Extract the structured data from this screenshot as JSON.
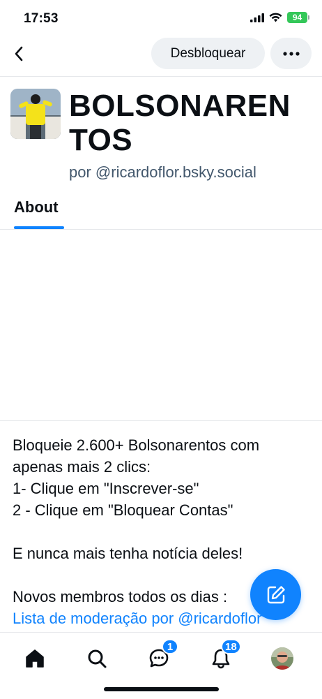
{
  "status_bar": {
    "time": "17:53",
    "battery": "94",
    "battery_color": "#34c759"
  },
  "nav": {
    "unblock_label": "Desbloquear"
  },
  "list": {
    "title": "BOLSONARENTOS",
    "owner": "por @ricardoflor.bsky.social"
  },
  "tabs": {
    "about_label": "About"
  },
  "description": {
    "paragraph1": "Bloqueie 2.600+ Bolsonarentos com apenas mais 2 clics:\n1- Clique em \"Inscrever-se\"\n2 - Clique em \"Bloquear Contas\"",
    "paragraph2": "E nunca mais tenha notícia deles!",
    "paragraph3": "Novos membros todos os dias :",
    "paragraph4": "Lista de moderação por @ricardoflor"
  },
  "tab_bar": {
    "chat_badge": "1",
    "notifications_badge": "18",
    "accent": "#1083fe"
  }
}
